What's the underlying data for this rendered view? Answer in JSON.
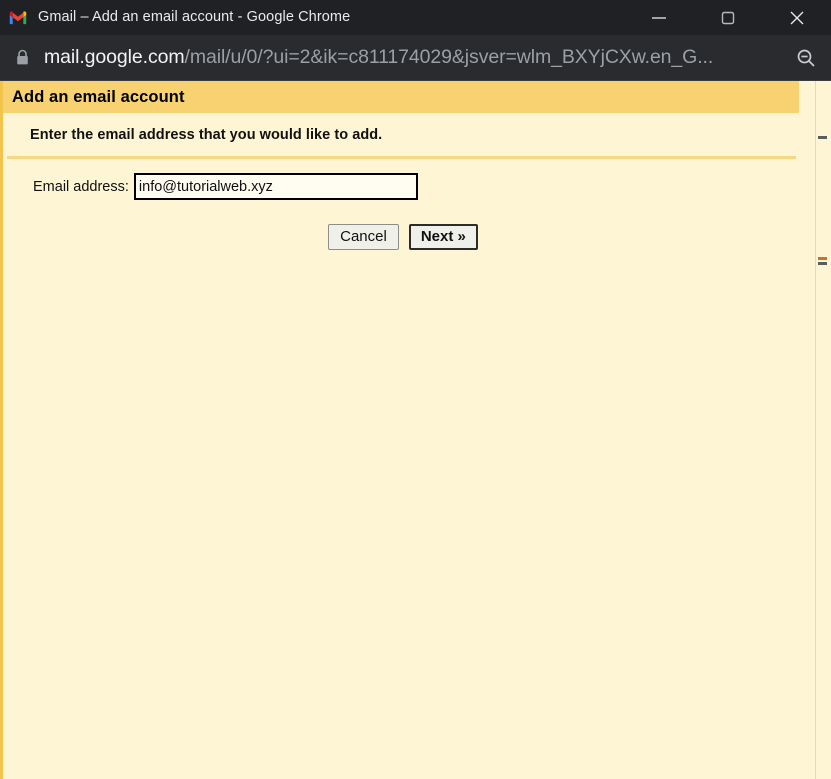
{
  "window": {
    "title": "Gmail – Add an email account - Google Chrome",
    "favicon": "gmail-logo-icon",
    "controls": {
      "minimize": "minimize-icon",
      "maximize": "maximize-icon",
      "close": "close-icon"
    }
  },
  "omnibox": {
    "lock_icon": "lock-icon",
    "host": "mail.google.com",
    "path": "/mail/u/0/?ui=2&ik=c811174029&jsver=wlm_BXYjCXw.en_G...",
    "full_url": "mail.google.com/mail/u/0/?ui=2&ik=c811174029&jsver=wlm_BXYjCXw.en_G...",
    "zoom_icon": "zoom-out-icon"
  },
  "page": {
    "header_title": "Add an email account",
    "instruction": "Enter the email address that you would like to add.",
    "form": {
      "email_label": "Email address:",
      "email_value": "info@tutorialweb.xyz",
      "email_placeholder": ""
    },
    "buttons": {
      "cancel": "Cancel",
      "next": "Next »"
    }
  },
  "colors": {
    "titlebar_bg": "#202124",
    "omnibox_bg": "#292b2e",
    "page_bg": "#FDF5D3",
    "header_band": "#F8D271",
    "divider": "#F5D784",
    "left_border": "#F3C44B"
  }
}
